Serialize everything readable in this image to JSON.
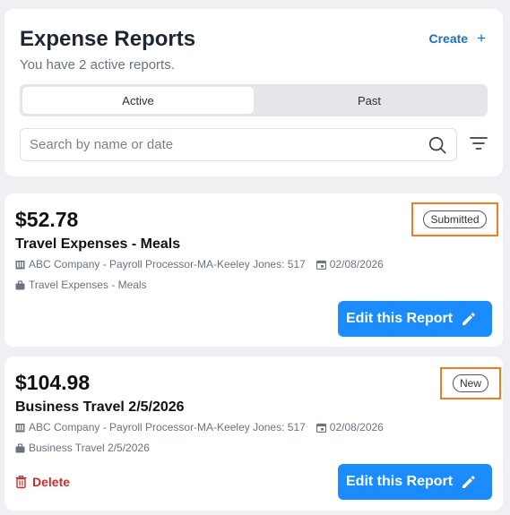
{
  "header": {
    "title": "Expense Reports",
    "subtitle": "You have 2 active reports.",
    "create_label": "Create",
    "create_icon": "+",
    "tabs": [
      {
        "label": "Active",
        "selected": true
      },
      {
        "label": "Past",
        "selected": false
      }
    ],
    "search": {
      "placeholder": "Search by name or date",
      "value": ""
    }
  },
  "reports": [
    {
      "amount": "$52.78",
      "title": "Travel Expenses - Meals",
      "company": "ABC Company - Payroll Processor-MA-Keeley Jones: 517",
      "date": "02/08/2026",
      "category": "Travel Expenses - Meals",
      "status": "Submitted",
      "edit_label": "Edit this Report"
    },
    {
      "amount": "$104.98",
      "title": "Business Travel 2/5/2026",
      "company": "ABC Company - Payroll Processor-MA-Keeley Jones: 517",
      "date": "02/08/2026",
      "category": "Business Travel 2/5/2026",
      "status": "New",
      "edit_label": "Edit this Report",
      "delete_label": "Delete"
    }
  ],
  "colors": {
    "accent": "#1a8cff",
    "link": "#1670c9",
    "highlight": "#f07c1f",
    "danger": "#c9302c"
  }
}
